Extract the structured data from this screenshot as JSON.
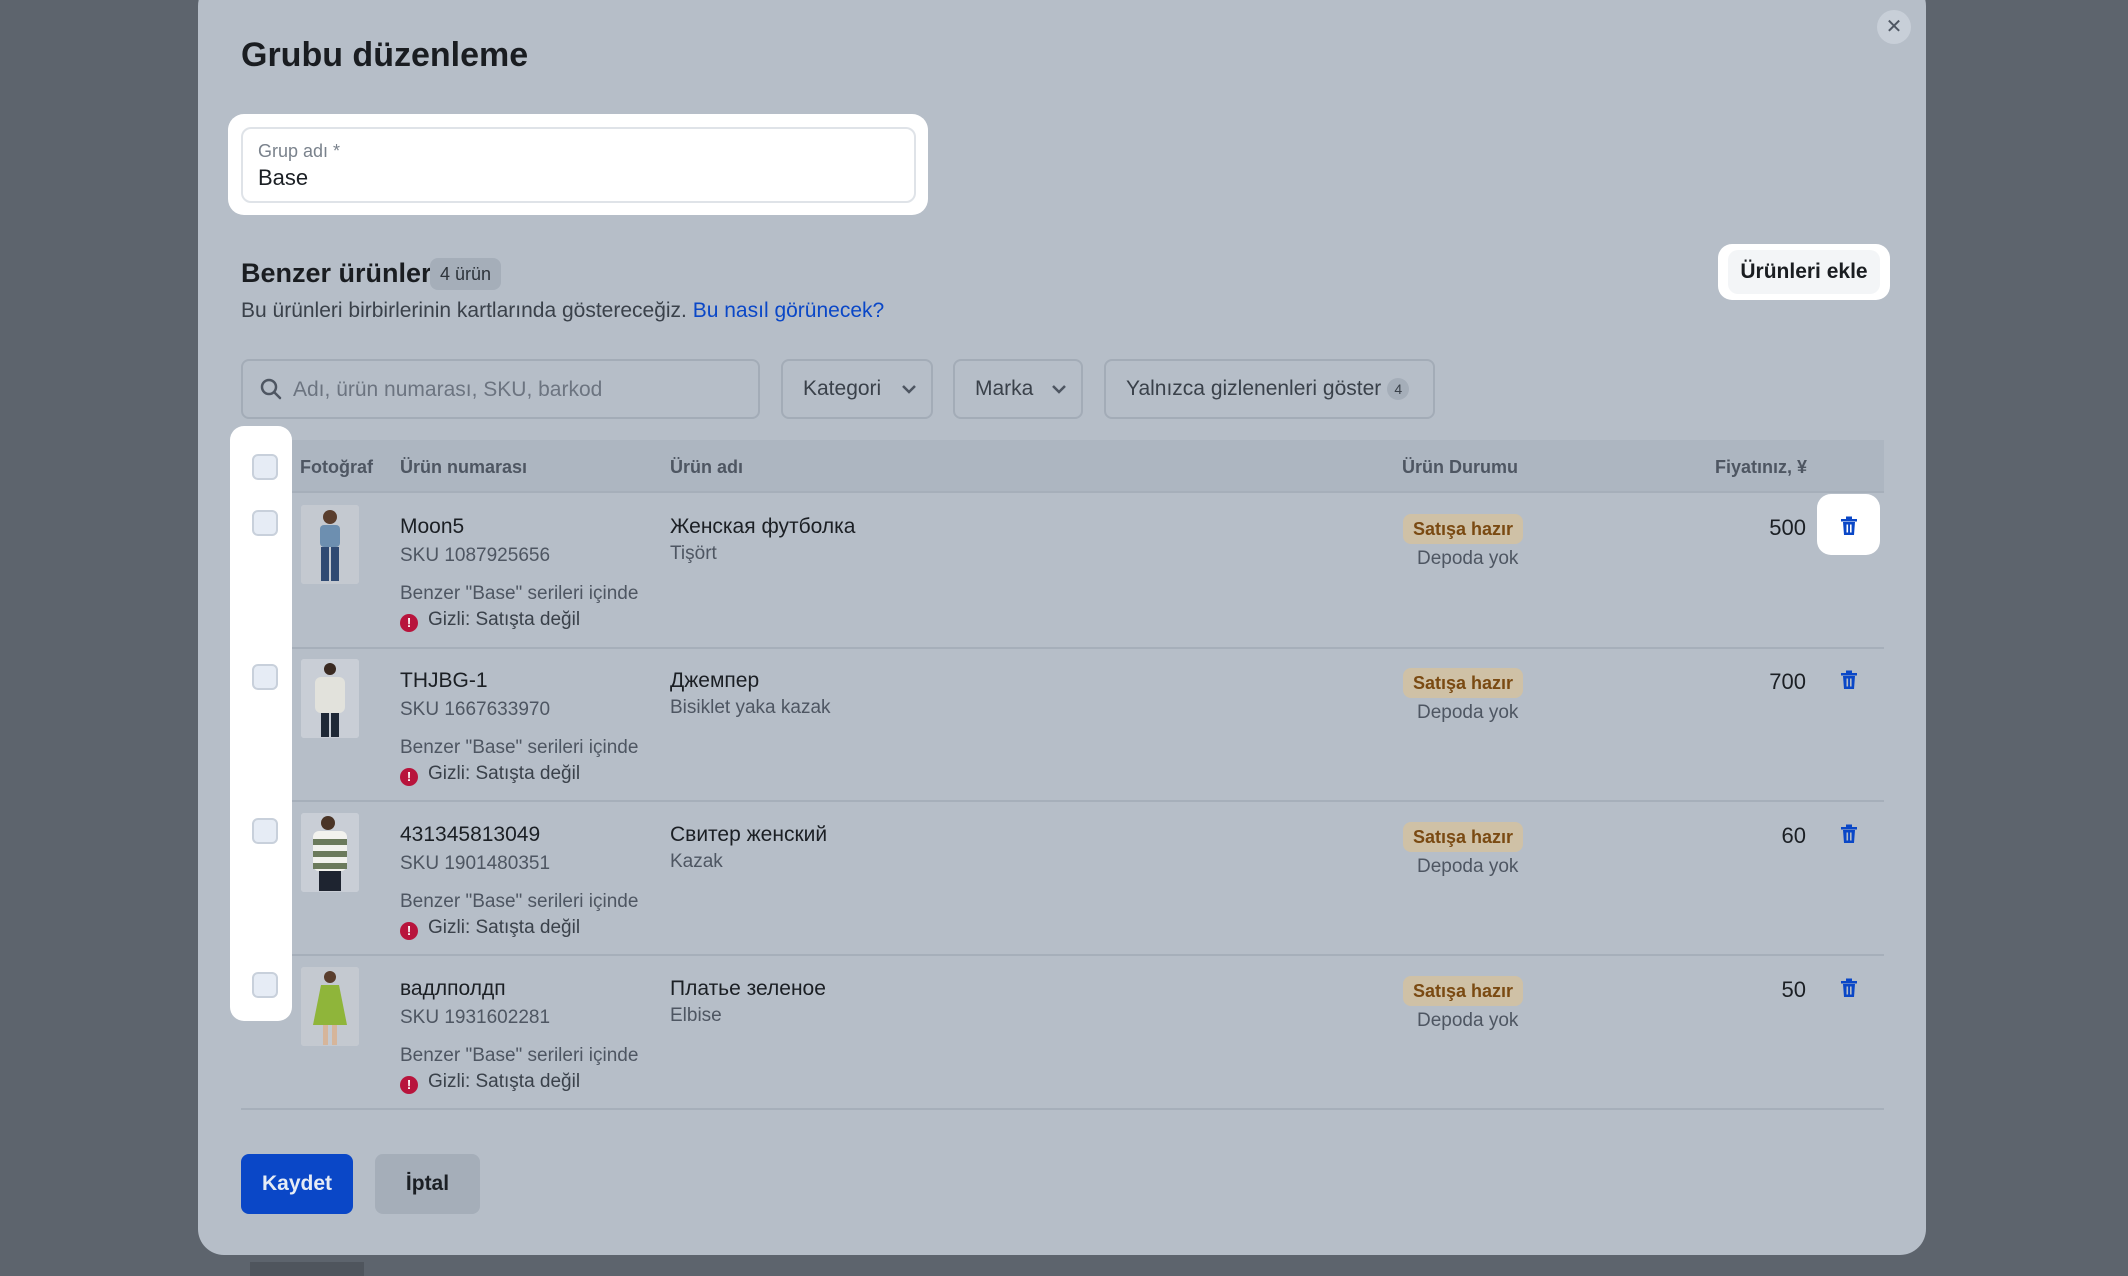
{
  "dialog": {
    "title": "Grubu düzenleme",
    "close_icon": "close-icon"
  },
  "group_name": {
    "label": "Grup adı *",
    "value": "Base"
  },
  "similar": {
    "title": "Benzer ürünler",
    "count_badge": "4 ürün",
    "description": "Bu ürünleri birbirlerinin kartlarında göstereceğiz.",
    "help_link": "Bu nasıl görünecek?",
    "add_button": "Ürünleri ekle"
  },
  "filters": {
    "search_placeholder": "Adı, ürün numarası, SKU, barkod",
    "category": "Kategori",
    "brand": "Marka",
    "hidden_only": "Yalnızca gizlenenleri göster",
    "hidden_count": "4"
  },
  "table": {
    "columns": [
      "Fotoğraf",
      "Ürün numarası",
      "Ürün adı",
      "Ürün Durumu",
      "Fiyatınız, ¥"
    ],
    "rows": [
      {
        "number": "Moon5",
        "sku": "SKU 1087925656",
        "series": "Benzer \"Base\" serileri içinde",
        "hidden": "Gizli: Satışta değil",
        "name": "Женская футболка",
        "category": "Tişört",
        "status": "Satışa hazır",
        "stock": "Depoda yok",
        "price": "500",
        "photo_color": "#6d8fb0"
      },
      {
        "number": "THJBG-1",
        "sku": "SKU 1667633970",
        "series": "Benzer \"Base\" serileri içinde",
        "hidden": "Gizli: Satışta değil",
        "name": "Джемпер",
        "category": "Bisiklet yaka kazak",
        "status": "Satışa hazır",
        "stock": "Depoda yok",
        "price": "700",
        "photo_color": "#d8d8d2"
      },
      {
        "number": "431345813049",
        "sku": "SKU 1901480351",
        "series": "Benzer \"Base\" serileri içinde",
        "hidden": "Gizli: Satışta değil",
        "name": "Свитер женский",
        "category": "Kazak",
        "status": "Satışa hazır",
        "stock": "Depoda yok",
        "price": "60",
        "photo_color": "#5f6d56"
      },
      {
        "number": "вадлполдп",
        "sku": "SKU 1931602281",
        "series": "Benzer \"Base\" serileri içinde",
        "hidden": "Gizli: Satışta değil",
        "name": "Платье зеленое",
        "category": "Elbise",
        "status": "Satışa hazır",
        "stock": "Depoda yok",
        "price": "50",
        "photo_color": "#8fb53a"
      }
    ]
  },
  "footer": {
    "save": "Kaydet",
    "cancel": "İptal"
  },
  "colors": {
    "accent": "#0a47c7",
    "warning": "#b8143c",
    "status_bg": "#cfc1a6"
  }
}
